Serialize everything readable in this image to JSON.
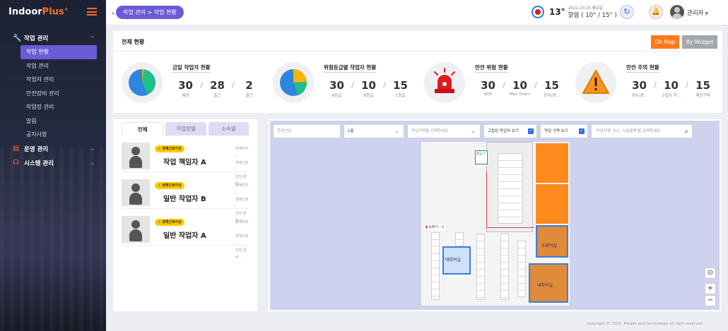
{
  "sidebar": {
    "logo_main": "Indoor",
    "logo_accent": "Plus",
    "logo_sup": "+",
    "groups": [
      {
        "label": "작업 관리",
        "icon": "wrench-icon"
      },
      {
        "label": "운영 관리",
        "icon": "document-icon"
      },
      {
        "label": "시스템 관리",
        "icon": "headset-icon"
      }
    ],
    "items": [
      "작업 현황",
      "작업 관리",
      "작업자 관리",
      "안전장비 관리",
      "작업장 관리",
      "알림",
      "공지사항"
    ]
  },
  "header": {
    "breadcrumb": "작업 관리 > 작업 현황",
    "temperature": "13°",
    "date": "2021-10-25 월요일",
    "weather": "맑음 ( 10° / 15° )",
    "username": "관리자"
  },
  "overview": {
    "title": "전체 현황",
    "btn_map": "On Map",
    "btn_widget": "By Widget",
    "stats": [
      {
        "label": "금일 작업자 현황",
        "values": [
          {
            "v": "30",
            "l": "예정"
          },
          {
            "v": "28",
            "l": "출근"
          },
          {
            "v": "2",
            "l": "결근"
          }
        ]
      },
      {
        "label": "위험등급별 작업자 현황",
        "values": [
          {
            "v": "30",
            "l": "A등급"
          },
          {
            "v": "10",
            "l": "B등급"
          },
          {
            "v": "15",
            "l": "C등급"
          }
        ]
      },
      {
        "label": "안전 위험 현황",
        "values": [
          {
            "v": "30",
            "l": "SOS"
          },
          {
            "v": "10",
            "l": "Man Down"
          },
          {
            "v": "15",
            "l": "장치/생..."
          }
        ]
      },
      {
        "label": "안전 주의 현황",
        "values": [
          {
            "v": "30",
            "l": "장치/생..."
          },
          {
            "v": "10",
            "l": "고립된 작..."
          },
          {
            "v": "15",
            "l": "제한구역"
          }
        ]
      }
    ]
  },
  "workers": {
    "tabs": [
      "전체",
      "작업장별",
      "소속별"
    ],
    "info_labels": [
      "현재위치 :",
      "생체신호 :",
      "안전 장비 :"
    ],
    "list": [
      {
        "badge": "생체신호이상",
        "name": "작업 책임자 A"
      },
      {
        "badge": "생체신호이상",
        "name": "일반 작업자 B"
      },
      {
        "badge": "생체신호이상",
        "name": "일반 작업자 A"
      }
    ]
  },
  "map": {
    "site_placeholder": "한국산업",
    "floor": "1층",
    "zone_placeholder": "작업구역을 선택하세요",
    "check_isolated": "고립된 작업자 보기",
    "check_zone": "작업 구역 보기",
    "search_placeholder": "'작업자명' 또는 '시설물명'을 입력하세요",
    "labels": {
      "exit": "출입구",
      "extinguisher": "소화기 - 1",
      "meeting_big": "대회의실",
      "meeting_small": "소회의실",
      "meeting_mid": "대회의실"
    }
  },
  "footer": "copyright © 2021. People and technology all right reserved",
  "colors": {
    "accent": "#6a5cd6",
    "orange": "#ff7a1a",
    "danger": "#e01b1b"
  }
}
